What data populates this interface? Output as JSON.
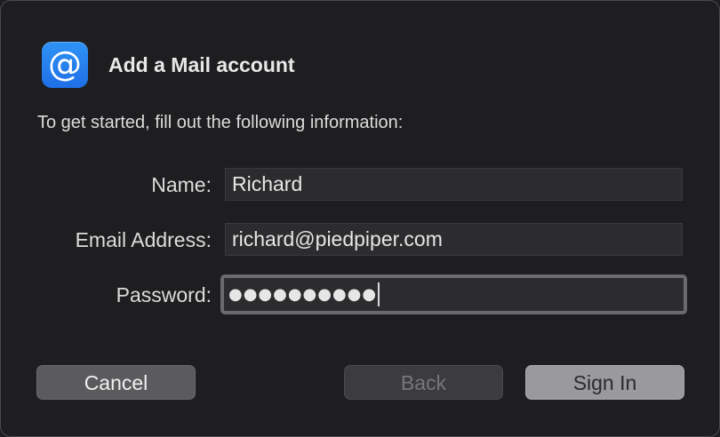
{
  "dialog": {
    "title": "Add a Mail account",
    "subtitle": "To get started, fill out the following information:",
    "icon": "at-sign-icon",
    "accent_color": "#2a86f2"
  },
  "form": {
    "name_label": "Name:",
    "name_value": "Richard",
    "email_label": "Email Address:",
    "email_value": "richard@piedpiper.com",
    "password_label": "Password:",
    "password_mask": "●●●●●●●●●●"
  },
  "buttons": {
    "cancel": "Cancel",
    "back": "Back",
    "sign_in": "Sign In"
  }
}
